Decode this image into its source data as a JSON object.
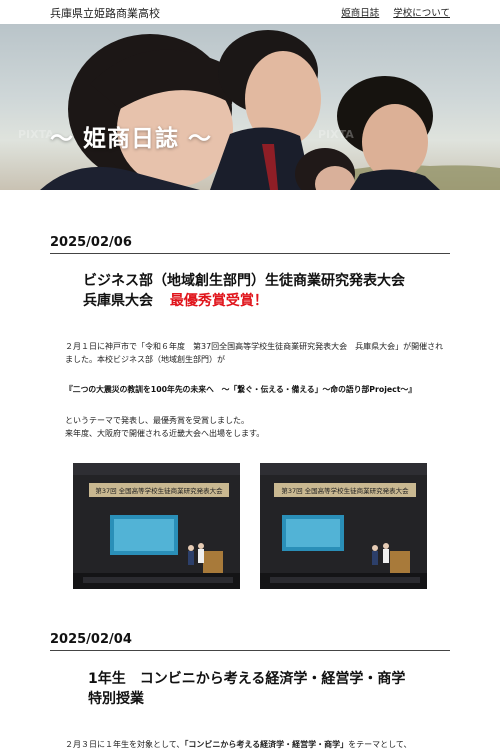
{
  "header": {
    "site_title": "兵庫県立姫路商業高校",
    "nav": [
      "姫商日誌",
      "学校について"
    ]
  },
  "hero": {
    "title": "〜 姫商日誌 〜",
    "watermark": "PIXTA"
  },
  "posts": [
    {
      "date": "2025/02/06",
      "title_line1": "ビジネス部（地域創生部門）生徒商業研究発表大会",
      "title_line2a": "兵庫県大会",
      "title_line2b": "最優秀賞受賞！",
      "para1": "２月１日に神戸市で「令和６年度　第37回全国高等学校生徒商業研究発表大会　兵庫県大会」が開催されました。本校ビジネス部（地域創生部門）が",
      "theme": "『二つの大震災の教訓を100年先の未来へ　～「繋ぐ・伝える・備える」～命の語り部Project～』",
      "para2": "というテーマで発表し、最優秀賞を受賞しました。",
      "para3": "来年度、大阪府で開催される近畿大会へ出場をします。",
      "photos": [
        {
          "banner": "第37回 全国高等学校生徒商業研究発表大会"
        },
        {
          "banner": "第37回 全国高等学校生徒商業研究発表大会"
        }
      ]
    },
    {
      "date": "2025/02/04",
      "title_line1": "1年生　コンビニから考える経済学・経営学・商学",
      "title_line2": "特別授業",
      "para_prefix": "２月３日に１年生を対象として、",
      "para_bold": "「コンビニから考える経済学・経営学・商学」",
      "para_suffix": "をテーマとして、"
    }
  ]
}
